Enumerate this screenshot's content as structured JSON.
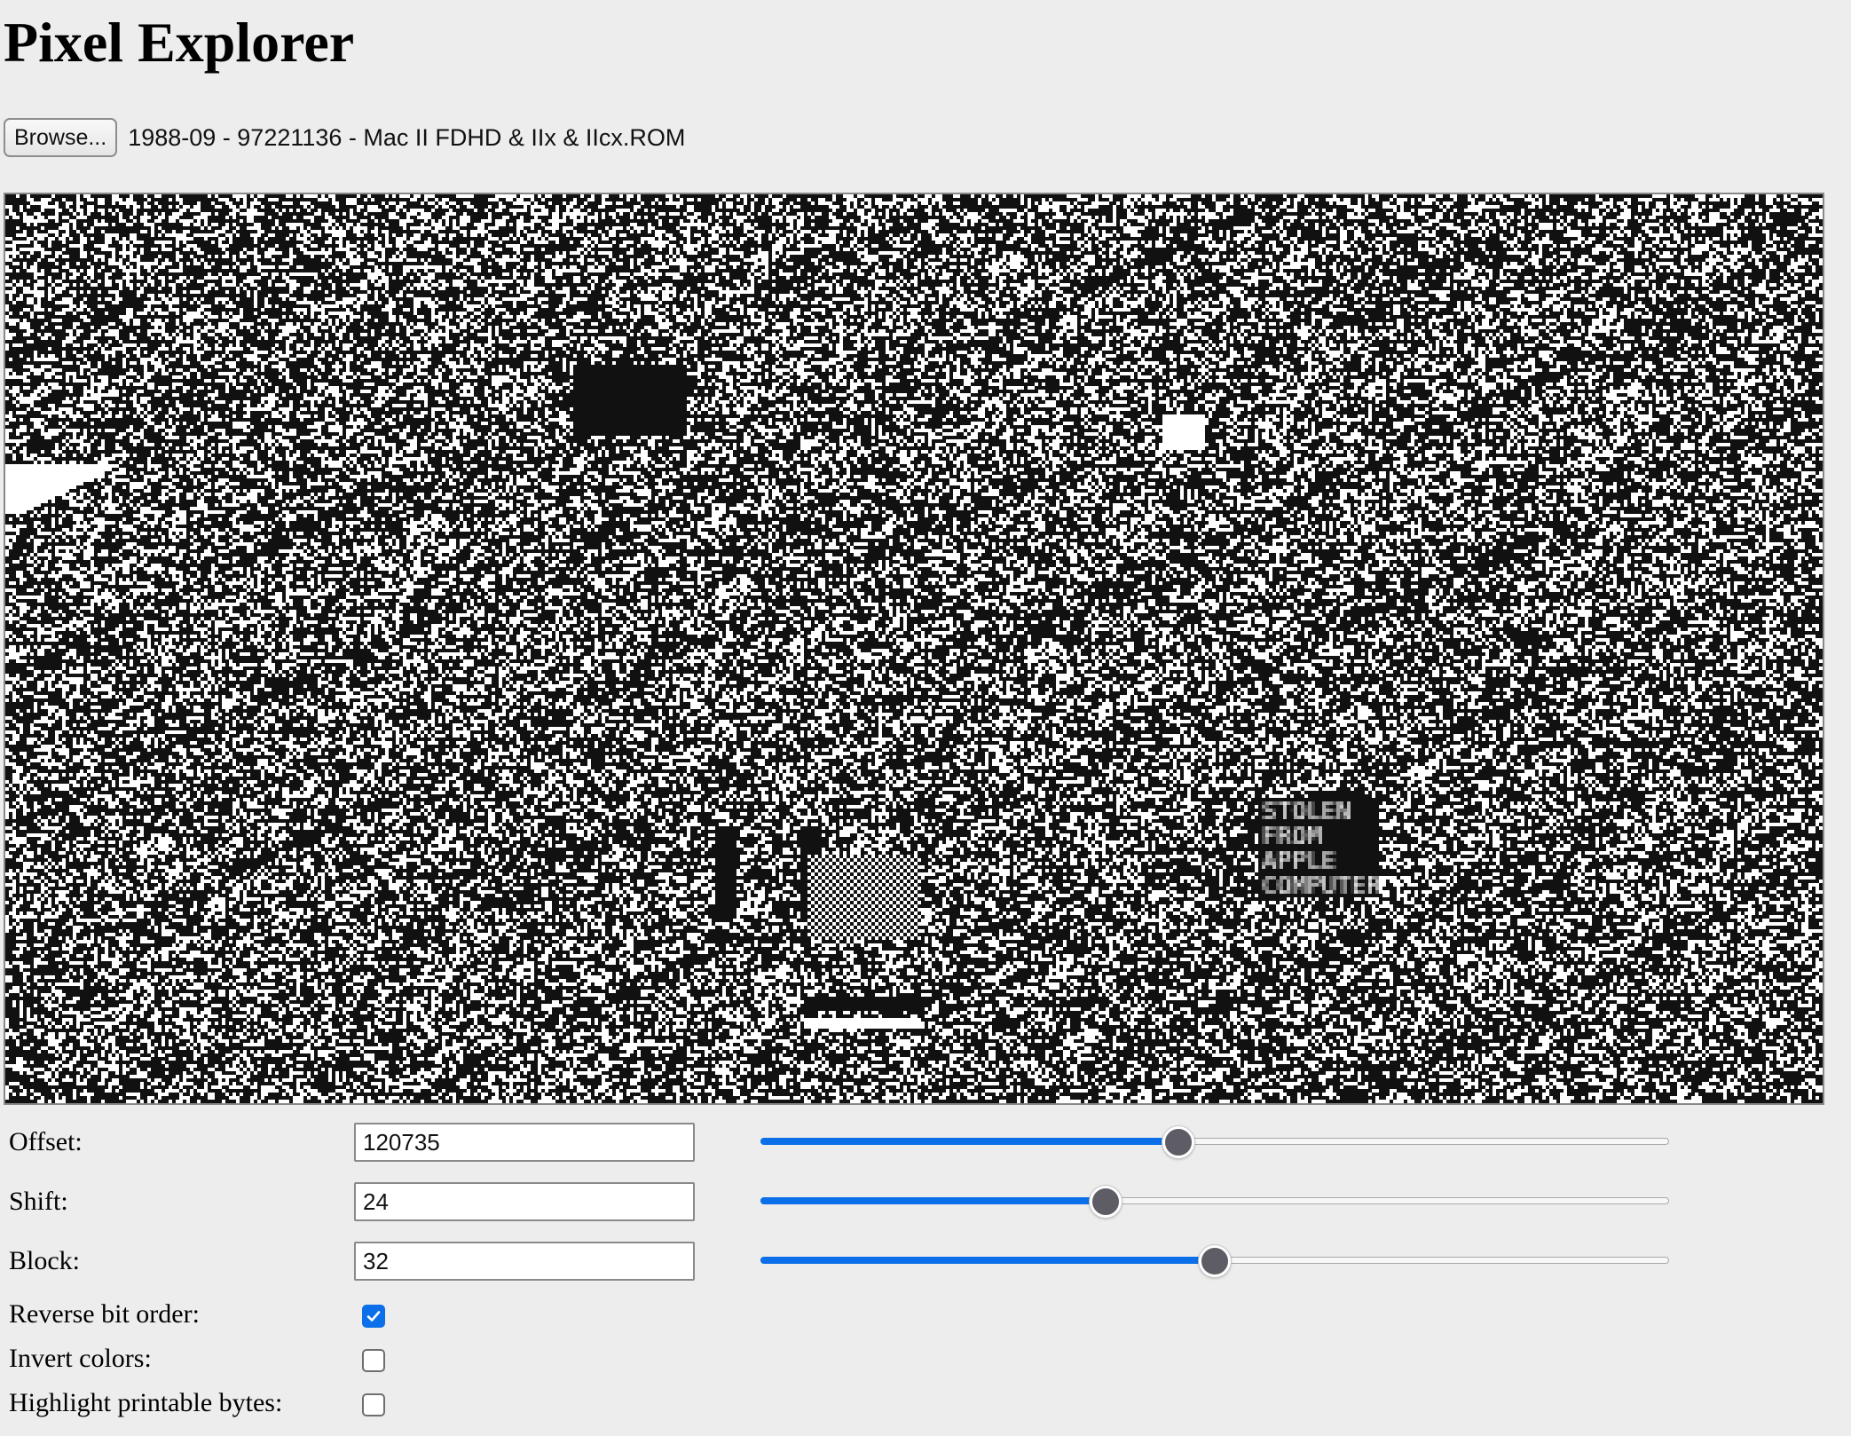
{
  "page": {
    "title": "Pixel Explorer"
  },
  "file": {
    "browse_label": "Browse...",
    "file_name": "1988-09 - 97221136 - Mac II FDHD & IIx & IIcx.ROM"
  },
  "canvas": {
    "embedded_text": [
      "STOLEN",
      "FROM",
      "APPLE",
      "COMPUTER"
    ]
  },
  "controls": {
    "offset": {
      "label": "Offset:",
      "value": "120735",
      "slider_fraction": 0.46
    },
    "shift": {
      "label": "Shift:",
      "value": "24",
      "slider_fraction": 0.38
    },
    "block": {
      "label": "Block:",
      "value": "32",
      "slider_fraction": 0.5
    },
    "reverse_bit_order": {
      "label": "Reverse bit order:",
      "checked": true
    },
    "invert_colors": {
      "label": "Invert colors:",
      "checked": false
    },
    "highlight_printable": {
      "label": "Highlight printable bytes:",
      "checked": false
    }
  },
  "colors": {
    "accent": "#0a6fe8",
    "pixel_on": "#111111",
    "pixel_off": "#ffffff",
    "background": "#ededed"
  }
}
